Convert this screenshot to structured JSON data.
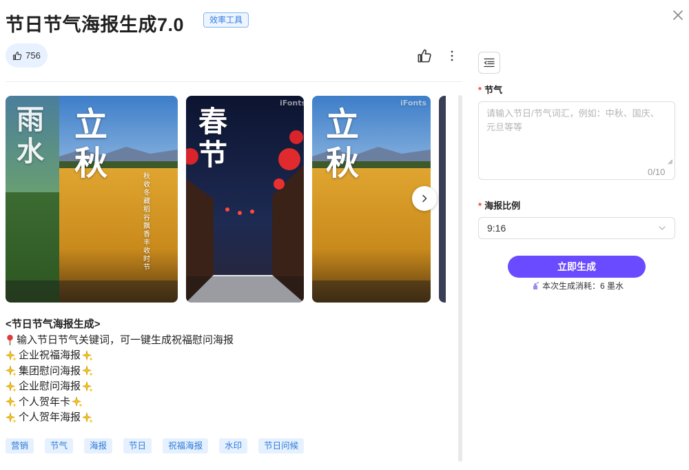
{
  "header": {
    "title": "节日节气海报生成7.0",
    "badge": "效率工具"
  },
  "actions": {
    "like_count": "756"
  },
  "carousel": {
    "posters": [
      {
        "title_left": "雨水",
        "title_main": "立秋",
        "side_text": "秋收冬藏 稻谷飘香 丰收时节"
      },
      {
        "title_main": "春节",
        "watermark": "iFonts"
      },
      {
        "title_main": "立秋",
        "watermark": "iFonts"
      }
    ]
  },
  "description": {
    "heading": "<节日节气海报生成>",
    "intro": "输入节日节气关键词，可一键生成祝福慰问海报",
    "items": [
      "企业祝福海报",
      "集团慰问海报",
      "企业慰问海报",
      "个人贺年卡",
      "个人贺年海报"
    ]
  },
  "tags": [
    "营销",
    "节气",
    "海报",
    "节日",
    "祝福海报",
    "水印",
    "节日问候"
  ],
  "form": {
    "festival_label": "节气",
    "festival_placeholder": "请输入节日/节气词汇，例如：中秋、国庆、元旦等等",
    "festival_counter": "0/10",
    "ratio_label": "海报比例",
    "ratio_value": "9:16",
    "generate_label": "立即生成",
    "cost_text": "本次生成消耗：6 墨水"
  },
  "colors": {
    "accent": "#6b4bff",
    "tag_text": "#2e7ad8",
    "tag_bg": "#e6f1ff",
    "required": "#f03e3e"
  }
}
